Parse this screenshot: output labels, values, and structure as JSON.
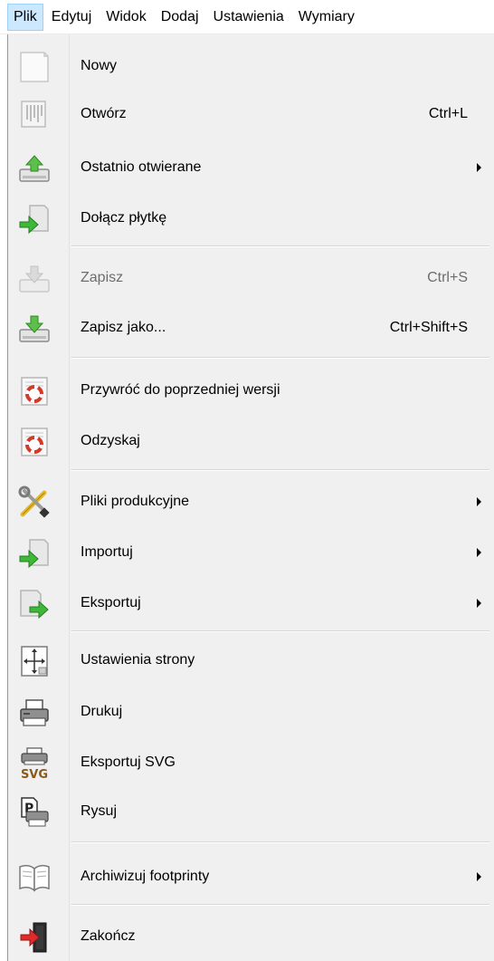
{
  "menubar": {
    "items": [
      {
        "label": "Plik",
        "active": true
      },
      {
        "label": "Edytuj"
      },
      {
        "label": "Widok"
      },
      {
        "label": "Dodaj"
      },
      {
        "label": "Ustawienia"
      },
      {
        "label": "Wymiary"
      }
    ]
  },
  "dropdown": {
    "items": [
      {
        "label": "Nowy",
        "icon": "new-document-icon"
      },
      {
        "label": "Otwórz",
        "shortcut": "Ctrl+L",
        "icon": "open-icon"
      },
      {
        "label": "Ostatnio otwierane",
        "icon": "recent-files-icon",
        "submenu": true
      },
      {
        "label": "Dołącz płytkę",
        "icon": "append-board-icon"
      },
      {
        "label": "Zapisz",
        "shortcut": "Ctrl+S",
        "icon": "save-icon",
        "disabled": true
      },
      {
        "label": "Zapisz jako...",
        "shortcut": "Ctrl+Shift+S",
        "icon": "save-as-icon"
      },
      {
        "label": "Przywróć do poprzedniej wersji",
        "icon": "lifebuoy-icon"
      },
      {
        "label": "Odzyskaj",
        "icon": "lifebuoy-icon"
      },
      {
        "label": "Pliki produkcyjne",
        "icon": "tools-icon",
        "submenu": true
      },
      {
        "label": "Importuj",
        "icon": "import-icon",
        "submenu": true
      },
      {
        "label": "Eksportuj",
        "icon": "export-icon",
        "submenu": true
      },
      {
        "label": "Ustawienia strony",
        "icon": "page-settings-icon"
      },
      {
        "label": "Drukuj",
        "icon": "printer-icon"
      },
      {
        "label": "Eksportuj SVG",
        "icon": "svg-export-icon",
        "badge": "SVG"
      },
      {
        "label": "Rysuj",
        "icon": "plot-icon"
      },
      {
        "label": "Archiwizuj footprinty",
        "icon": "book-icon",
        "submenu": true
      },
      {
        "label": "Zakończ",
        "icon": "exit-icon"
      }
    ]
  }
}
